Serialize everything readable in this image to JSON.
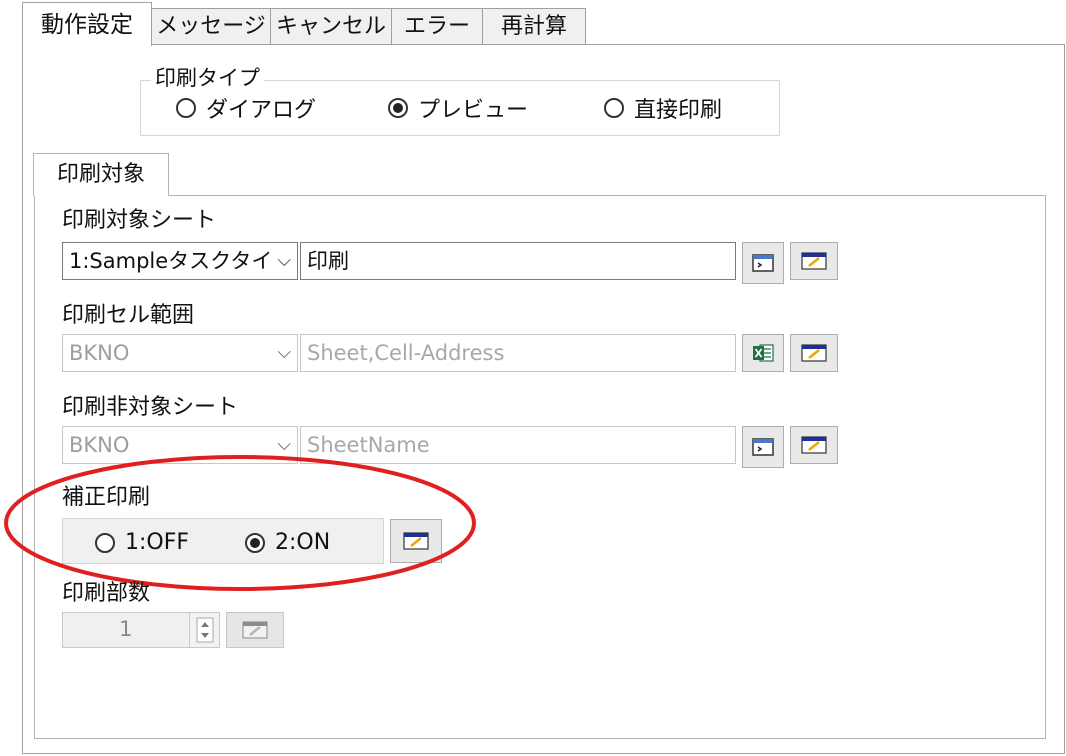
{
  "tabs": [
    {
      "label": "動作設定",
      "active": true
    },
    {
      "label": "メッセージ"
    },
    {
      "label": "キャンセル"
    },
    {
      "label": "エラー"
    },
    {
      "label": "再計算"
    }
  ],
  "print_type": {
    "title": "印刷タイプ",
    "options": [
      "ダイアログ",
      "プレビュー",
      "直接印刷"
    ],
    "selected": "プレビュー"
  },
  "inner_tab": {
    "label": "印刷対象"
  },
  "print_target_sheet": {
    "label": "印刷対象シート",
    "combo_value": "1:Sampleタスクタイ",
    "text_value": "印刷"
  },
  "print_cell_range": {
    "label": "印刷セル範囲",
    "combo_value": "BKNO",
    "text_placeholder": "Sheet,Cell-Address"
  },
  "print_non_target_sheet": {
    "label": "印刷非対象シート",
    "combo_value": "BKNO",
    "text_placeholder": "SheetName"
  },
  "correction_print": {
    "label": "補正印刷",
    "options": [
      "1:OFF",
      "2:ON"
    ],
    "selected": "2:ON"
  },
  "print_copies": {
    "label": "印刷部数",
    "value": "1"
  },
  "icons": {
    "edit": "edit-icon",
    "sheet": "sheet-select-icon",
    "excel": "excel-icon",
    "spin": "spinner-arrows-icon"
  },
  "colors": {
    "highlight": "#e02020",
    "disabled_text": "#9e9e9e"
  }
}
